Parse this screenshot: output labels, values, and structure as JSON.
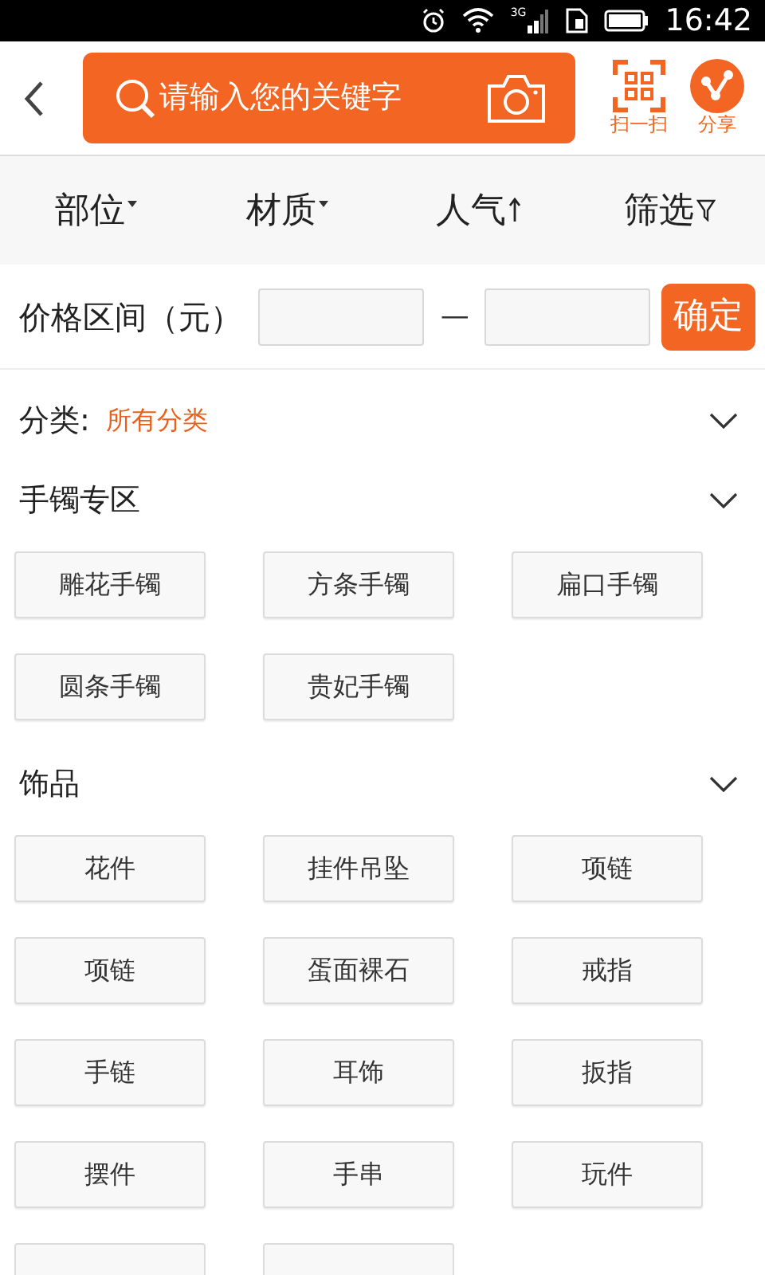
{
  "status_bar": {
    "network": "3G",
    "time": "16:42"
  },
  "header": {
    "search_placeholder": "请输入您的关键字",
    "scan_label": "扫一扫",
    "share_label": "分享"
  },
  "sort_tabs": [
    {
      "label": "部位",
      "kind": "dropdown"
    },
    {
      "label": "材质",
      "kind": "dropdown"
    },
    {
      "label": "人气",
      "kind": "sort"
    },
    {
      "label": "筛选",
      "kind": "filter"
    }
  ],
  "price_filter": {
    "label": "价格区间（元）",
    "separator": "—",
    "confirm": "确定"
  },
  "category": {
    "label": "分类:",
    "value": "所有分类",
    "expanded": false
  },
  "sections": [
    {
      "title": "手镯专区",
      "expanded": false,
      "items": [
        "雕花手镯",
        "方条手镯",
        "扁口手镯",
        "圆条手镯",
        "贵妃手镯"
      ]
    },
    {
      "title": "饰品",
      "expanded": false,
      "items": [
        "花件",
        "挂件吊坠",
        "项链",
        "项链",
        "蛋面裸石",
        "戒指",
        "手链",
        "耳饰",
        "扳指",
        "摆件",
        "手串",
        "玩件"
      ],
      "cut_off_items": [
        {
          "kind": "button"
        },
        {
          "kind": "button"
        }
      ]
    }
  ]
}
